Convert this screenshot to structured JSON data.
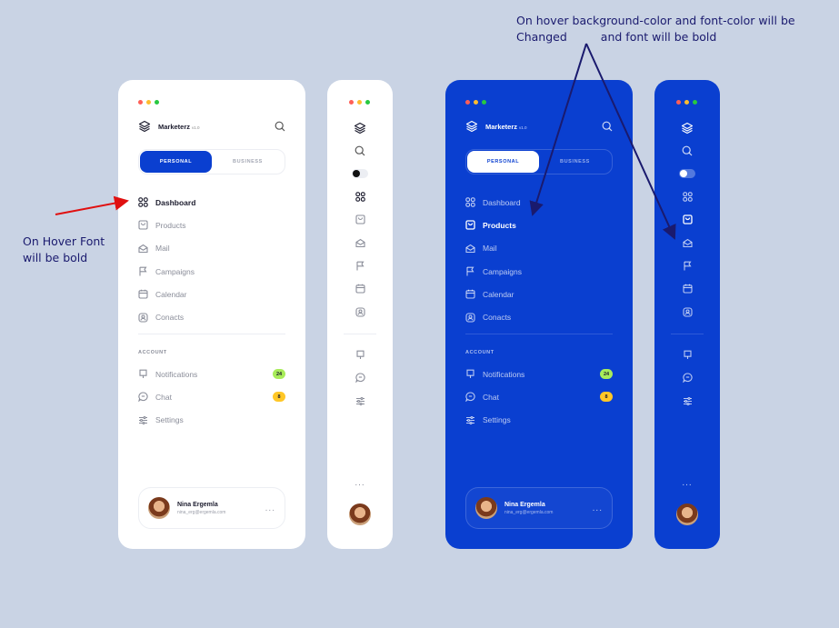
{
  "annotations": {
    "hover_note": "On Hover Font will be bold",
    "top_note_line1": "On hover background-color and font-color will be",
    "top_note_line2_left": "Changed",
    "top_note_line2_right": "and font will be bold"
  },
  "colors": {
    "background": "#c9d3e4",
    "accent_blue": "#0a3fd0",
    "badge_green": "#a8ec5a",
    "badge_yellow": "#ffc727",
    "arrow_red": "#e01010",
    "arrow_navy": "#1a1a6e"
  },
  "brand": {
    "name": "Marketerz",
    "version": "v1.0",
    "icon": "layers-icon"
  },
  "segment": {
    "personal": "PERSONAL",
    "business": "BUSINESS"
  },
  "menu": [
    {
      "label": "Dashboard",
      "icon": "grid-icon"
    },
    {
      "label": "Products",
      "icon": "bag-icon"
    },
    {
      "label": "Mail",
      "icon": "mail-icon"
    },
    {
      "label": "Campaigns",
      "icon": "flag-icon"
    },
    {
      "label": "Calendar",
      "icon": "calendar-icon"
    },
    {
      "label": "Conacts",
      "icon": "contacts-icon"
    }
  ],
  "account": {
    "label": "ACCOUNT",
    "items": [
      {
        "label": "Notifications",
        "badge": "24",
        "icon": "bell-icon"
      },
      {
        "label": "Chat",
        "badge": "8",
        "icon": "chat-icon"
      },
      {
        "label": "Settings",
        "icon": "sliders-icon"
      }
    ]
  },
  "profile": {
    "name": "Nina Ergemla",
    "email": "nina_erg@ergemla.com",
    "more": "..."
  },
  "hover_state": {
    "white_panel_bold_item": "Dashboard",
    "blue_panel_bold_item": "Products"
  }
}
